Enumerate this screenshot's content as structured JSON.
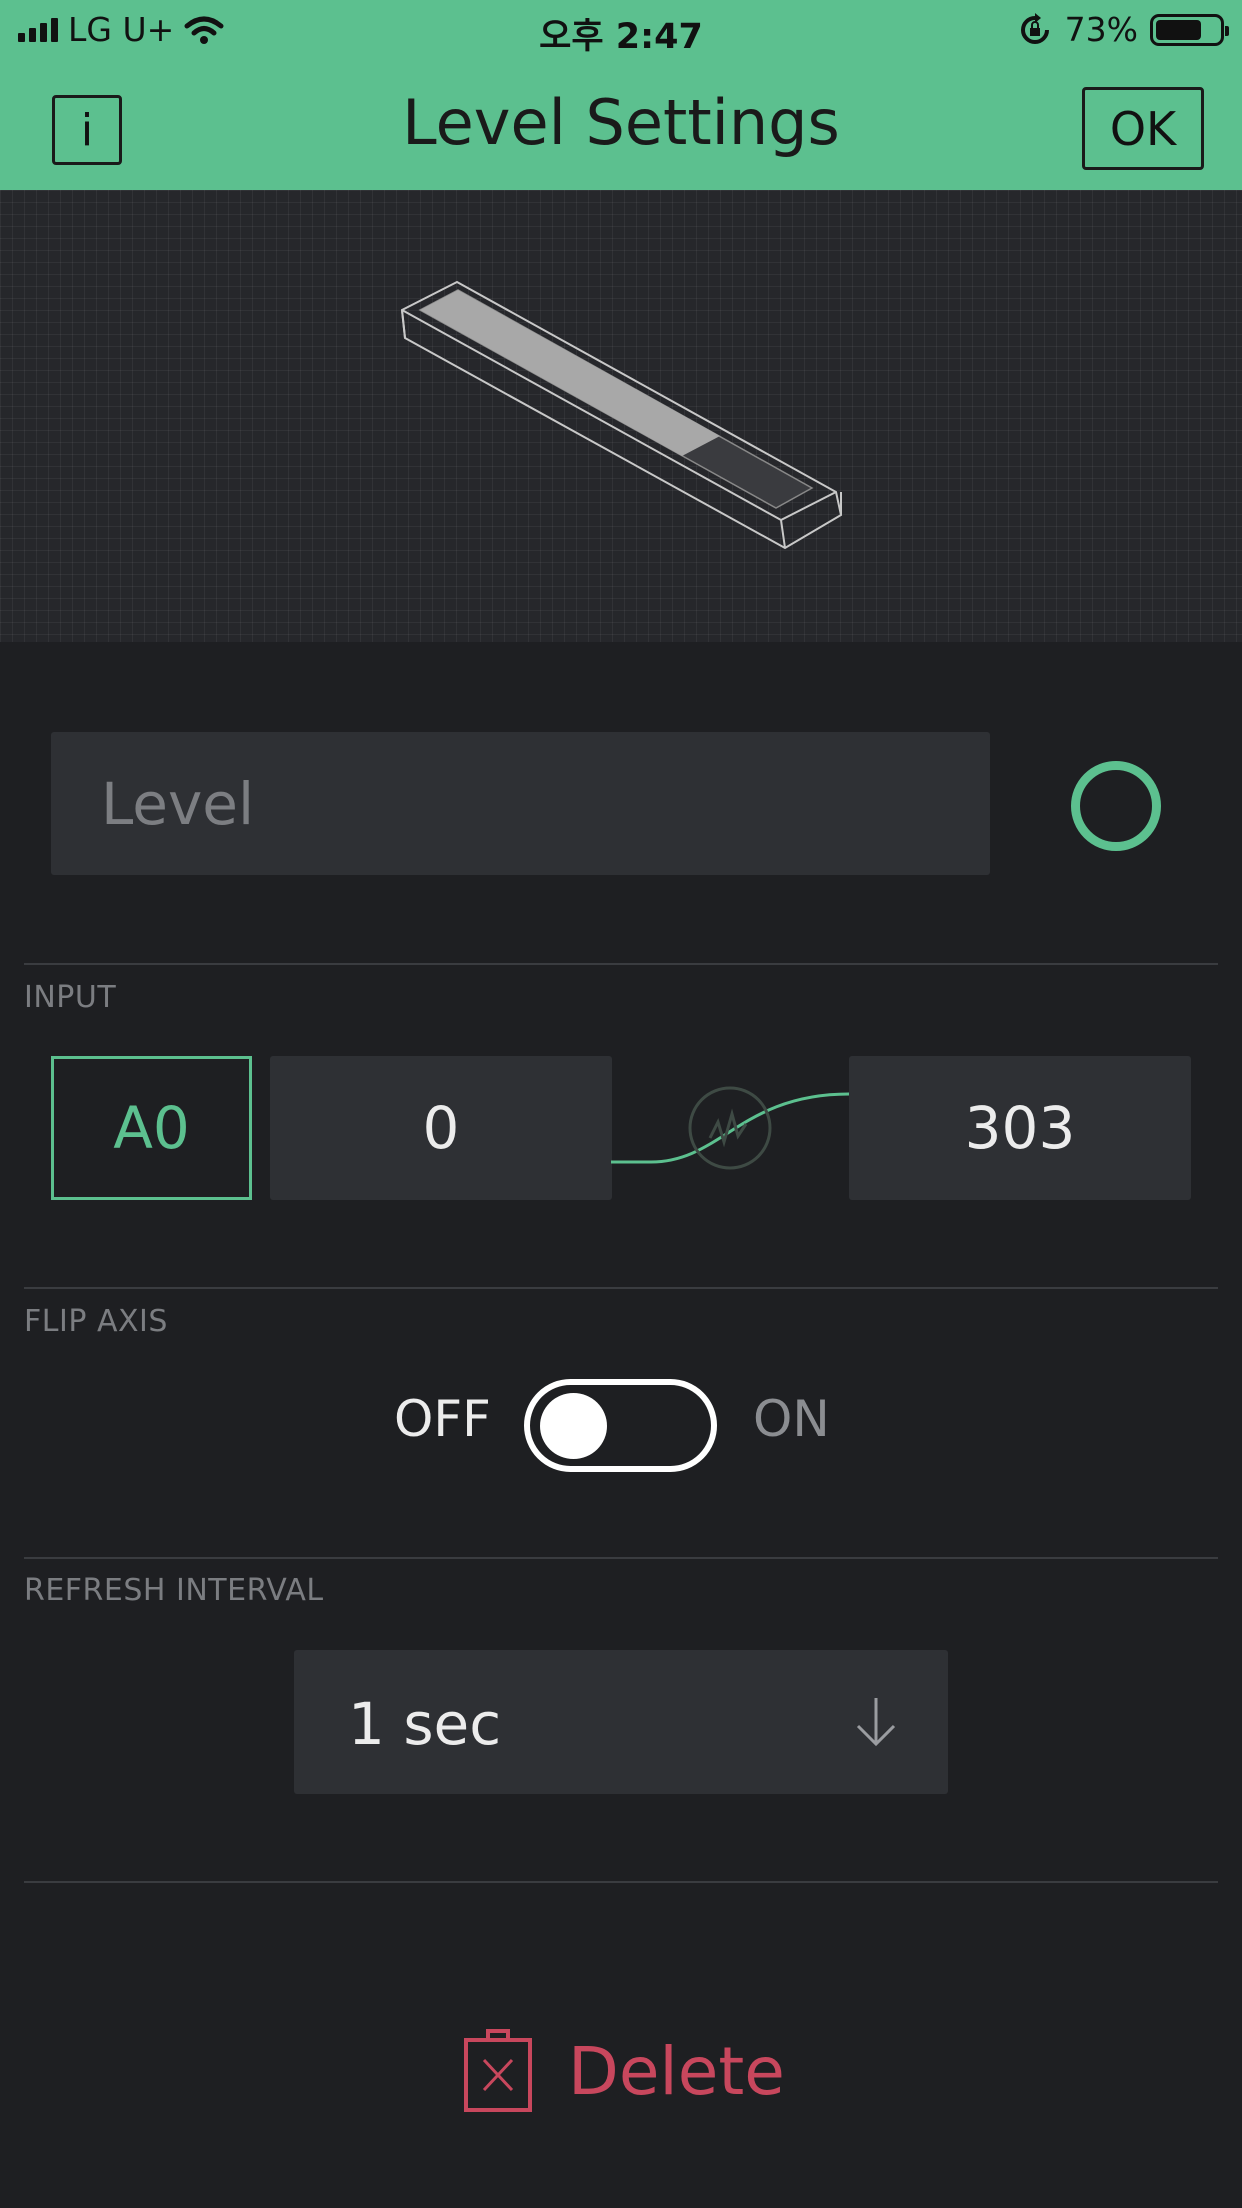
{
  "status_bar": {
    "carrier": "LG U+",
    "time": "오후 2:47",
    "battery_percent": "73%",
    "battery_level": 0.73
  },
  "nav": {
    "info_label": "i",
    "title": "Level Settings",
    "ok_label": "OK"
  },
  "widget": {
    "name_placeholder": "Level",
    "color": "#5cc08f"
  },
  "input": {
    "section_label": "INPUT",
    "pin": "A0",
    "min": "0",
    "max": "303"
  },
  "flip_axis": {
    "section_label": "FLIP AXIS",
    "off_label": "OFF",
    "on_label": "ON",
    "enabled": false
  },
  "refresh": {
    "section_label": "REFRESH INTERVAL",
    "value": "1 sec"
  },
  "delete": {
    "label": "Delete"
  },
  "colors": {
    "accent": "#5cc08f",
    "background": "#1e1f22",
    "field": "#2e3034",
    "danger": "#c8475d"
  }
}
